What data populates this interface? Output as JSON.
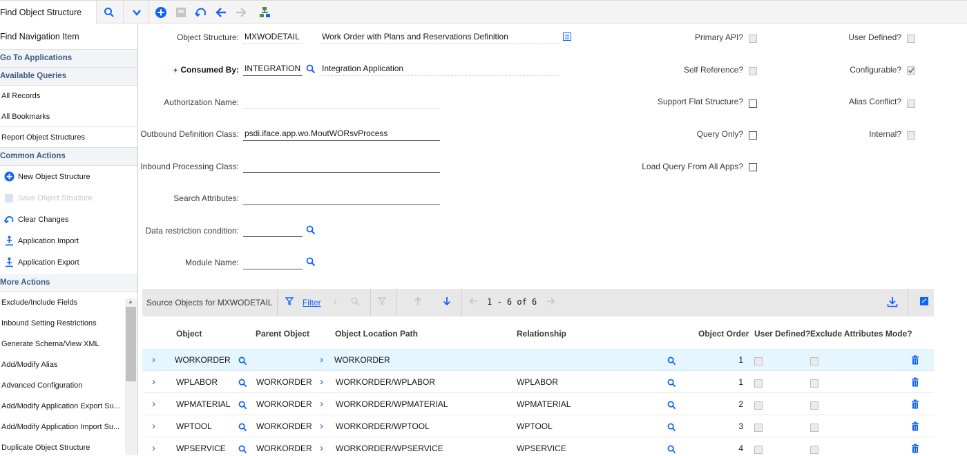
{
  "toolbar": {
    "find_placeholder": "Find Object Structure"
  },
  "sidebar": {
    "nav_item": "Find Navigation Item",
    "go_to": "Go To Applications",
    "available_queries": "Available Queries",
    "queries": [
      "All Records",
      "All Bookmarks",
      "Report Object Structures"
    ],
    "common_actions": "Common Actions",
    "actions": [
      "New Object Structure",
      "Save Object Structure",
      "Clear Changes",
      "Application Import",
      "Application Export"
    ],
    "more_actions": "More Actions",
    "more": [
      "Exclude/Include Fields",
      "Inbound Setting Restrictions",
      "Generate Schema/View XML",
      "Add/Modify Alias",
      "Advanced Configuration",
      "Add/Modify Application Export Su...",
      "Add/Modify Application Import Su...",
      "Duplicate Object Structure"
    ]
  },
  "form": {
    "object_structure_label": "Object Structure:",
    "object_structure": "MXWODETAIL",
    "description": "Work Order with Plans and Reservations Definition",
    "consumed_by_label": "Consumed By:",
    "consumed_by": "INTEGRATION",
    "consumed_by_desc": "Integration Application",
    "authorization_label": "Authorization Name:",
    "outbound_label": "Outbound Definition Class:",
    "outbound": "psdi.iface.app.wo.MoutWORsvProcess",
    "inbound_label": "Inbound Processing Class:",
    "search_attr_label": "Search Attributes:",
    "data_restriction_label": "Data restriction condition:",
    "module_label": "Module Name:",
    "primary_api": "Primary API?",
    "self_reference": "Self Reference?",
    "support_flat": "Support Flat Structure?",
    "query_only": "Query Only?",
    "load_query": "Load Query From All Apps?",
    "user_defined": "User Defined?",
    "configurable": "Configurable?",
    "alias_conflict": "Alias Conflict?",
    "internal": "Internal?"
  },
  "table": {
    "title": "Source Objects for MXWODETAIL",
    "filter": "Filter",
    "pager": "1 - 6 of 6",
    "headers": {
      "object": "Object",
      "parent": "Parent Object",
      "path": "Object Location Path",
      "relationship": "Relationship",
      "order": "Object Order",
      "user_defined": "User Defined?",
      "exclude": "Exclude Attributes Mode?"
    },
    "rows": [
      {
        "object": "WORKORDER",
        "parent": "",
        "path": "WORKORDER",
        "relationship": "",
        "order": "1"
      },
      {
        "object": "WPLABOR",
        "parent": "WORKORDER",
        "path": "WORKORDER/WPLABOR",
        "relationship": "WPLABOR",
        "order": "1"
      },
      {
        "object": "WPMATERIAL",
        "parent": "WORKORDER",
        "path": "WORKORDER/WPMATERIAL",
        "relationship": "WPMATERIAL",
        "order": "2"
      },
      {
        "object": "WPTOOL",
        "parent": "WORKORDER",
        "path": "WORKORDER/WPTOOL",
        "relationship": "WPTOOL",
        "order": "3"
      },
      {
        "object": "WPSERVICE",
        "parent": "WORKORDER",
        "path": "WORKORDER/WPSERVICE",
        "relationship": "WPSERVICE",
        "order": "4"
      }
    ]
  }
}
